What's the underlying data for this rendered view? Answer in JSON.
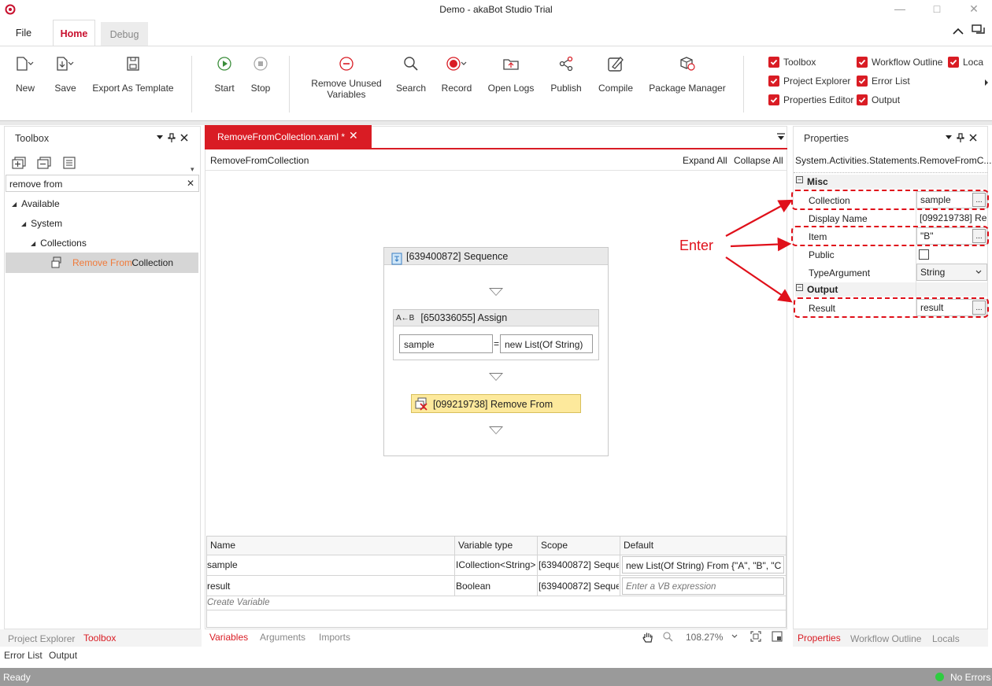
{
  "window": {
    "title": "Demo - akaBot Studio Trial"
  },
  "menu_tabs": {
    "file": "File",
    "home": "Home",
    "debug": "Debug"
  },
  "ribbon": {
    "new": "New",
    "save": "Save",
    "export_template": "Export As Template",
    "start": "Start",
    "stop": "Stop",
    "remove_unused_line1": "Remove Unused",
    "remove_unused_line2": "Variables",
    "search": "Search",
    "record": "Record",
    "open_logs": "Open Logs",
    "publish": "Publish",
    "compile": "Compile",
    "package_manager": "Package Manager"
  },
  "view_toggles": {
    "toolbox": "Toolbox",
    "workflow_outline": "Workflow Outline",
    "locals": "Loca",
    "project_explorer": "Project Explorer",
    "error_list": "Error List",
    "properties_editor": "Properties Editor",
    "output": "Output"
  },
  "toolbox": {
    "title": "Toolbox",
    "search_value": "remove from",
    "tree": {
      "available": "Available",
      "system": "System",
      "collections": "Collections",
      "item_highlight": "Remove From",
      "item_rest": " Collection"
    }
  },
  "designer": {
    "tab_label": "RemoveFromCollection.xaml *",
    "breadcrumb": "RemoveFromCollection",
    "expand_all": "Expand All",
    "collapse_all": "Collapse All",
    "sequence_title": "[639400872] Sequence",
    "assign_title": "[650336055] Assign",
    "assign_icon_text": "A←B",
    "assign_left": "sample",
    "assign_eq": "=",
    "assign_right": "new List(Of String)",
    "remove_activity": "[099219738] Remove From"
  },
  "variables": {
    "headers": [
      "Name",
      "Variable type",
      "Scope",
      "Default"
    ],
    "rows": [
      {
        "name": "sample",
        "type": "ICollection<String>",
        "scope": "[639400872] Seque",
        "default": "new List(Of String) From {\"A\", \"B\", \"C\""
      },
      {
        "name": "result",
        "type": "Boolean",
        "scope": "[639400872] Seque",
        "default": "Enter a VB expression"
      }
    ],
    "create": "Create Variable"
  },
  "designer_tabs": {
    "variables": "Variables",
    "arguments": "Arguments",
    "imports": "Imports",
    "zoom": "108.27%"
  },
  "properties": {
    "title": "Properties",
    "type_name": "System.Activities.Statements.RemoveFromC...",
    "misc": "Misc",
    "output": "Output",
    "rows": {
      "collection": {
        "label": "Collection",
        "value": "sample"
      },
      "display_name": {
        "label": "Display Name",
        "value": "[099219738] Ren"
      },
      "item": {
        "label": "Item",
        "value": "\"B\""
      },
      "public": {
        "label": "Public"
      },
      "type_argument": {
        "label": "TypeArgument",
        "value": "String"
      },
      "result": {
        "label": "Result",
        "value": "result"
      }
    },
    "dots": "..."
  },
  "annotation": {
    "text": "Enter"
  },
  "left_bottom_tabs": {
    "project_explorer": "Project Explorer",
    "toolbox": "Toolbox",
    "error_list": "Error List",
    "output": "Output"
  },
  "right_bottom_tabs": {
    "properties": "Properties",
    "workflow_outline": "Workflow Outline",
    "locals": "Locals"
  },
  "status": {
    "left": "Ready",
    "right": "No Errors"
  },
  "colors": {
    "accent": "#d91c24",
    "status_bar": "#9a9a9a",
    "highlight_item": "#f07a3a"
  }
}
